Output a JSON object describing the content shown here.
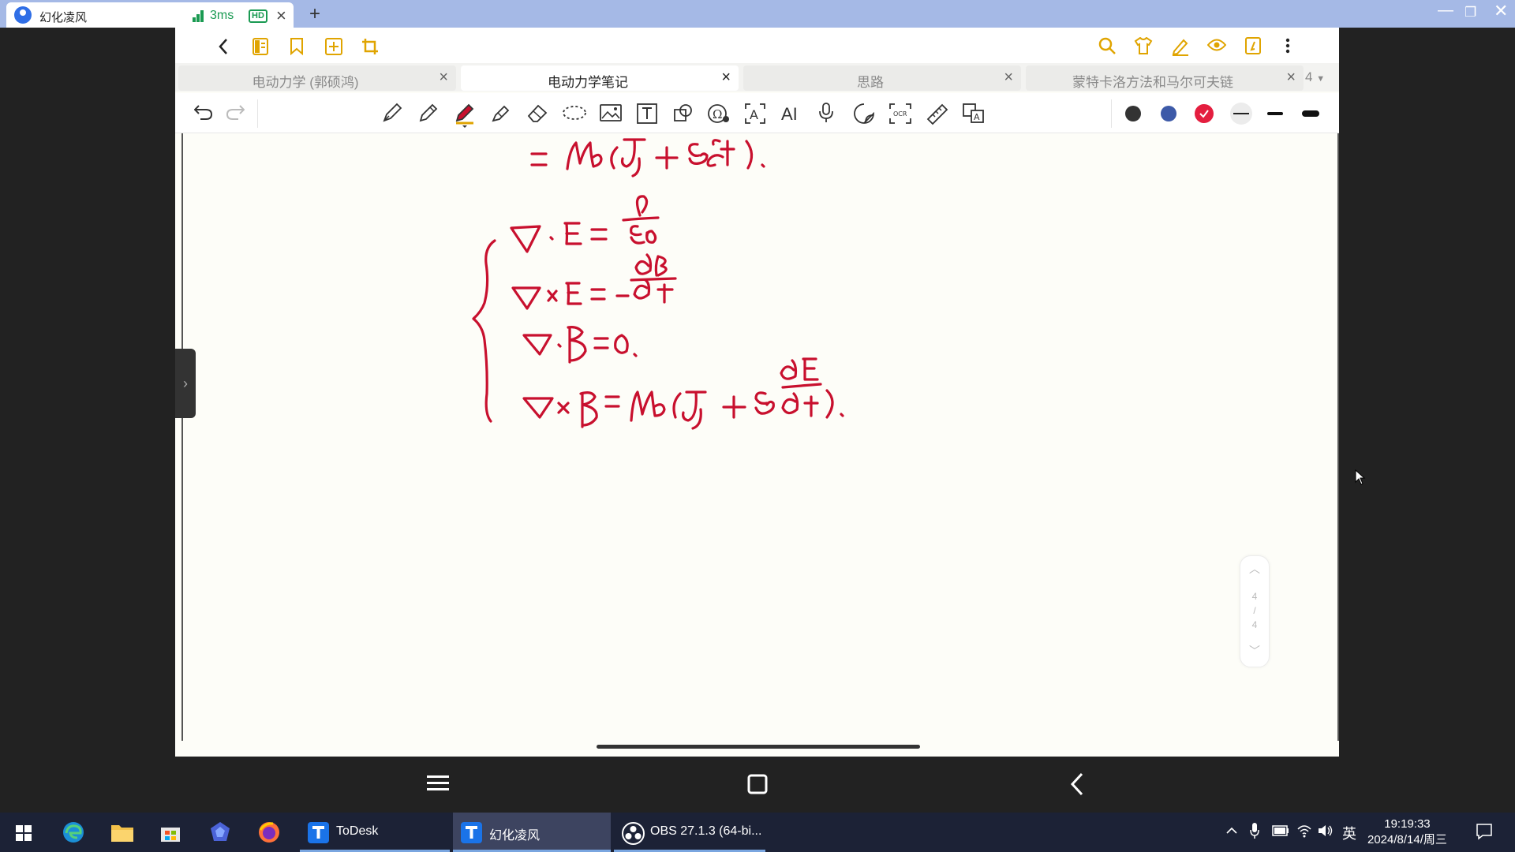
{
  "window": {
    "tab_title": "幻化凌风",
    "latency": "3ms",
    "quality_badge": "HD",
    "signal_color": "#1a9a52"
  },
  "app": {
    "tabs": [
      {
        "label": "电动力学 (郭硕鸿)",
        "active": false
      },
      {
        "label": "电动力学笔记",
        "active": true
      },
      {
        "label": "思路",
        "active": false
      },
      {
        "label": "蒙特卡洛方法和马尔可夫链",
        "active": false
      }
    ],
    "tab_count": "4",
    "accent_color": "#e0a400",
    "ink_color": "#c8102e",
    "pen_colors": [
      "#333333",
      "#3d5aa8",
      "#e41e3f"
    ],
    "text_tool_label": "AI"
  },
  "pager": {
    "current": "4",
    "separator": "/",
    "total": "4"
  },
  "taskbar": {
    "apps": [
      {
        "label": "ToDesk"
      },
      {
        "label": "幻化凌风"
      },
      {
        "label": "OBS 27.1.3 (64-bi..."
      }
    ],
    "ime": "英",
    "time": "19:19:33",
    "date": "2024/8/14/周三"
  }
}
